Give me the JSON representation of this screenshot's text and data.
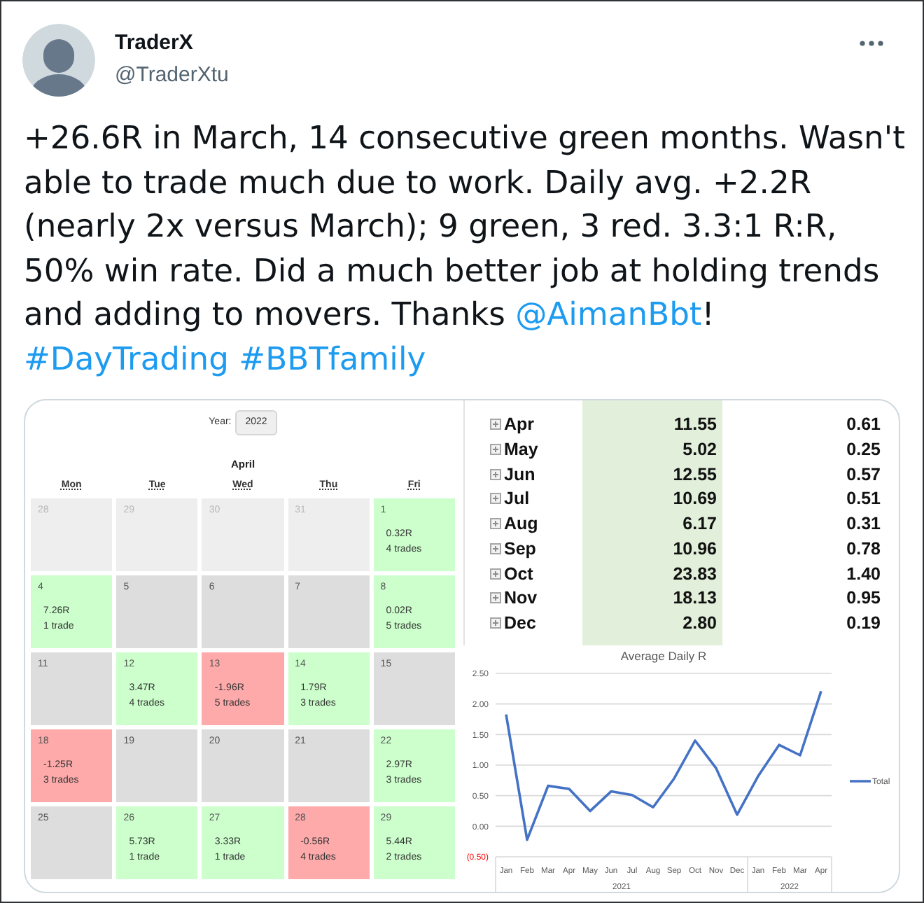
{
  "author": {
    "name": "TraderX",
    "handle": "@TraderXtu"
  },
  "tweet": {
    "parts": [
      {
        "kind": "text",
        "text": "+26.6R in March, 14 consecutive green months. Wasn't able to trade much due to work. Daily avg. +2.2R (nearly 2x versus March); 9 green, 3 red. 3.3:1 R:R, 50% win rate. Did a much better job at holding trends and adding to movers. Thanks "
      },
      {
        "kind": "mention",
        "text": "@AimanBbt"
      },
      {
        "kind": "text",
        "text": "!"
      }
    ],
    "hashtags": [
      "#DayTrading",
      "#BBTfamily"
    ]
  },
  "calendar": {
    "year_label": "Year:",
    "year": "2022",
    "month": "April",
    "weekdays": [
      "Mon",
      "Tue",
      "Wed",
      "Thu",
      "Fri"
    ],
    "weeks": [
      [
        {
          "day": "28",
          "kind": "outside"
        },
        {
          "day": "29",
          "kind": "outside"
        },
        {
          "day": "30",
          "kind": "outside"
        },
        {
          "day": "31",
          "kind": "outside"
        },
        {
          "day": "1",
          "kind": "win",
          "r": "0.32R",
          "trades": "4 trades"
        }
      ],
      [
        {
          "day": "4",
          "kind": "win",
          "r": "7.26R",
          "trades": "1 trade"
        },
        {
          "day": "5",
          "kind": "empty"
        },
        {
          "day": "6",
          "kind": "empty"
        },
        {
          "day": "7",
          "kind": "empty"
        },
        {
          "day": "8",
          "kind": "win",
          "r": "0.02R",
          "trades": "5 trades"
        }
      ],
      [
        {
          "day": "11",
          "kind": "empty"
        },
        {
          "day": "12",
          "kind": "win",
          "r": "3.47R",
          "trades": "4 trades"
        },
        {
          "day": "13",
          "kind": "loss",
          "r": "-1.96R",
          "trades": "5 trades"
        },
        {
          "day": "14",
          "kind": "win",
          "r": "1.79R",
          "trades": "3 trades"
        },
        {
          "day": "15",
          "kind": "empty"
        }
      ],
      [
        {
          "day": "18",
          "kind": "loss",
          "r": "-1.25R",
          "trades": "3 trades"
        },
        {
          "day": "19",
          "kind": "empty"
        },
        {
          "day": "20",
          "kind": "empty"
        },
        {
          "day": "21",
          "kind": "empty"
        },
        {
          "day": "22",
          "kind": "win",
          "r": "2.97R",
          "trades": "3 trades"
        }
      ],
      [
        {
          "day": "25",
          "kind": "empty"
        },
        {
          "day": "26",
          "kind": "win",
          "r": "5.73R",
          "trades": "1 trade"
        },
        {
          "day": "27",
          "kind": "win",
          "r": "3.33R",
          "trades": "1 trade"
        },
        {
          "day": "28",
          "kind": "loss",
          "r": "-0.56R",
          "trades": "4 trades"
        },
        {
          "day": "29",
          "kind": "win",
          "r": "5.44R",
          "trades": "2 trades"
        }
      ]
    ]
  },
  "table": {
    "rows": [
      {
        "label": "Apr",
        "column_2": "11.55",
        "column_3": "0.61"
      },
      {
        "label": "May",
        "column_2": "5.02",
        "column_3": "0.25"
      },
      {
        "label": "Jun",
        "column_2": "12.55",
        "column_3": "0.57"
      },
      {
        "label": "Jul",
        "column_2": "10.69",
        "column_3": "0.51"
      },
      {
        "label": "Aug",
        "column_2": "6.17",
        "column_3": "0.31"
      },
      {
        "label": "Sep",
        "column_2": "10.96",
        "column_3": "0.78"
      },
      {
        "label": "Oct",
        "column_2": "23.83",
        "column_3": "1.40"
      },
      {
        "label": "Nov",
        "column_2": "18.13",
        "column_3": "0.95"
      },
      {
        "label": "Dec",
        "column_2": "2.80",
        "column_3": "0.19"
      }
    ]
  },
  "chart": {
    "chart_data": {
      "type": "line",
      "title": "Average Daily R",
      "categories": [
        "Jan",
        "Feb",
        "Mar",
        "Apr",
        "May",
        "Jun",
        "Jul",
        "Aug",
        "Sep",
        "Oct",
        "Nov",
        "Dec",
        "Jan",
        "Feb",
        "Mar",
        "Apr"
      ],
      "series": [
        {
          "name": "Total",
          "color": "#4472c4",
          "values": [
            1.83,
            -0.22,
            0.66,
            0.61,
            0.25,
            0.57,
            0.51,
            0.31,
            0.78,
            1.4,
            0.95,
            0.19,
            0.82,
            1.33,
            1.16,
            2.21
          ]
        }
      ],
      "ylim": [
        -0.5,
        2.5
      ],
      "yticks": [
        {
          "value": 2.5,
          "label": "2.50"
        },
        {
          "value": 2,
          "label": "2.00"
        },
        {
          "value": 1.5,
          "label": "1.50"
        },
        {
          "value": 1,
          "label": "1.00"
        },
        {
          "value": 0.5,
          "label": "0.50"
        },
        {
          "value": 0,
          "label": "0.00"
        },
        {
          "value": -0.5,
          "label": "(0.50)"
        }
      ],
      "grid": true,
      "annotations": [
        "2021",
        "2022"
      ]
    }
  }
}
